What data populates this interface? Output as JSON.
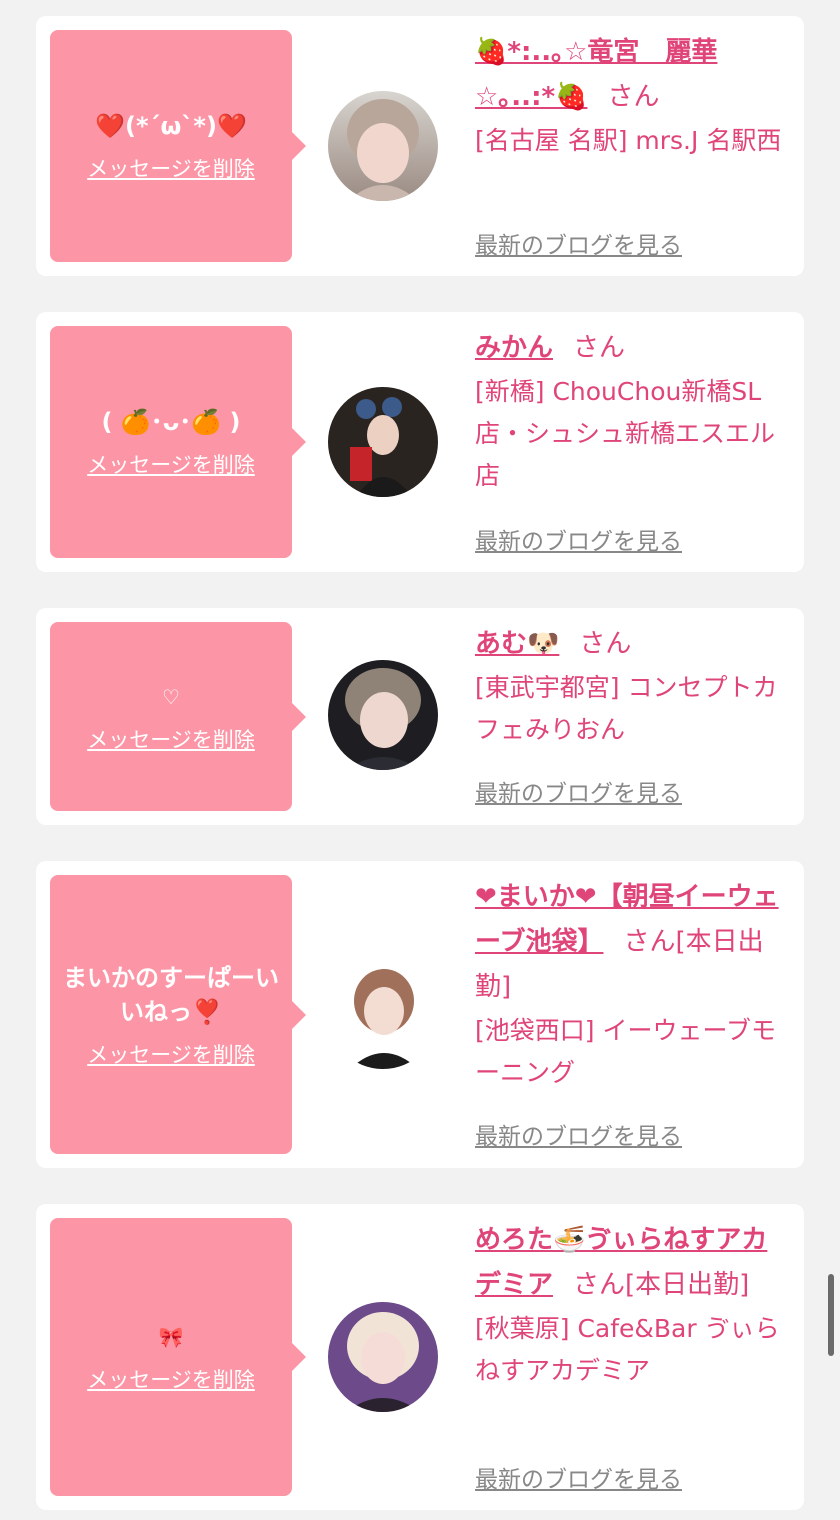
{
  "favorites": [
    {
      "message": "❤️(*´ω`*)❤️",
      "delete_label": "メッセージを削除",
      "name": "🍓*:..｡☆竜宮　麗華☆｡..:*🍓",
      "suffix": "さん",
      "shop": "[名古屋 名駅] mrs.J 名駅西",
      "blog_label": "最新のブログを見る"
    },
    {
      "message": "( 🍊･ᴗ･🍊 )",
      "delete_label": "メッセージを削除",
      "name": "みかん",
      "suffix": "さん",
      "shop": "[新橋] ChouChou新橋SL店・シュシュ新橋エスエル店",
      "blog_label": "最新のブログを見る"
    },
    {
      "message": "♡",
      "delete_label": "メッセージを削除",
      "name": "あむ🐶",
      "suffix": "さん",
      "shop": "[東武宇都宮] コンセプトカフェみりおん",
      "blog_label": "最新のブログを見る"
    },
    {
      "message": "まいかのすーぱーいいねっ❣️",
      "delete_label": "メッセージを削除",
      "name": "❤まいか❤【朝昼イーウェーブ池袋】",
      "suffix": "さん[本日出勤]",
      "shop": "[池袋西口] イーウェーブモーニング",
      "blog_label": "最新のブログを見る"
    },
    {
      "message": "🎀",
      "delete_label": "メッセージを削除",
      "name": "めろた🍜ゔぃらねすアカデミア",
      "suffix": "さん[本日出勤]",
      "shop": "[秋葉原] Cafe&Bar ゔぃらねすアカデミア",
      "blog_label": "最新のブログを見る"
    }
  ],
  "colors": {
    "bubble": "#fc96a6",
    "accent": "#e0457a",
    "muted": "#888888",
    "background": "#f2f2f2"
  }
}
